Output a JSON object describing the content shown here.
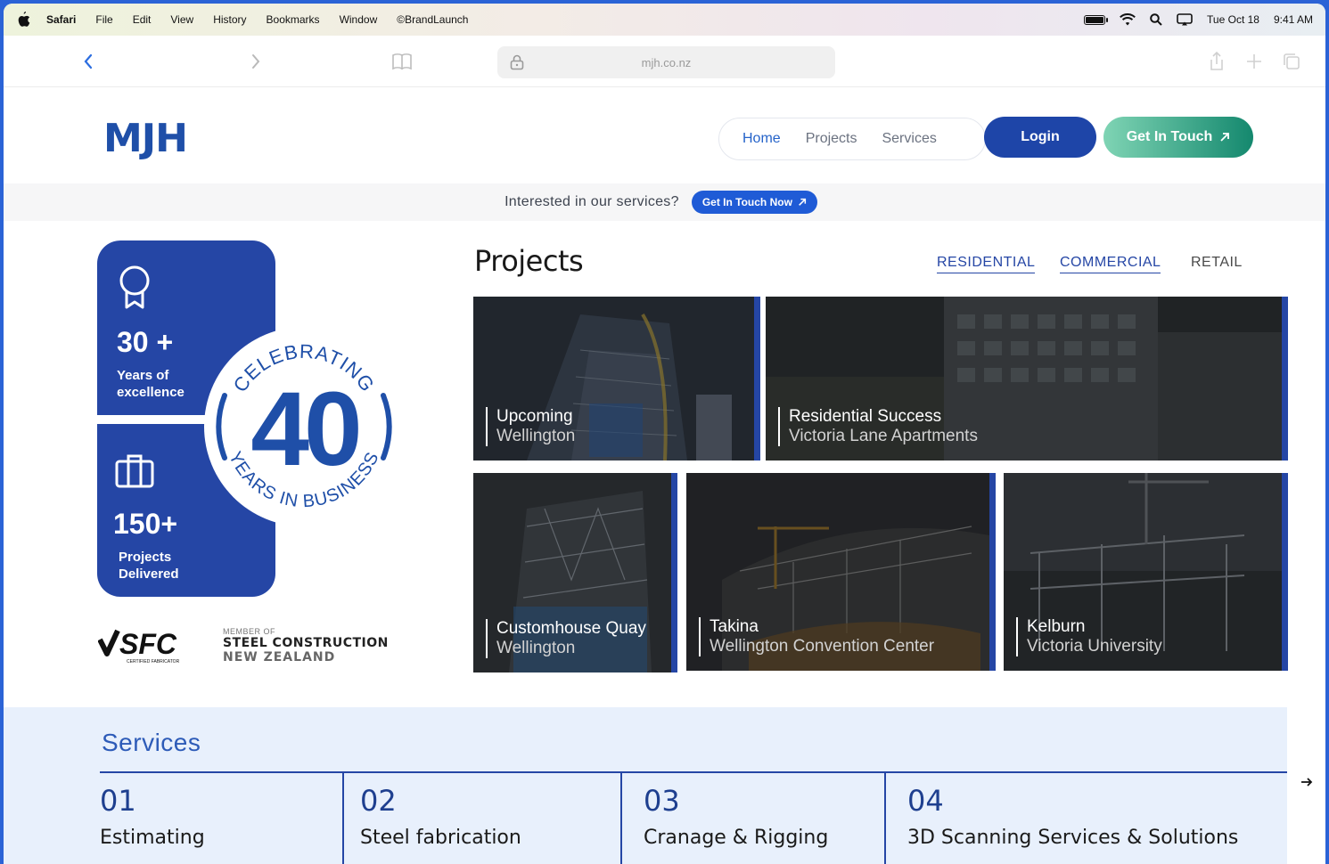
{
  "menubar": {
    "items": [
      "Safari",
      "File",
      "Edit",
      "View",
      "History",
      "Bookmarks",
      "Window",
      "©BrandLaunch"
    ],
    "date": "Tue Oct 18",
    "time": "9:41 AM"
  },
  "browser": {
    "url": "mjh.co.nz"
  },
  "site": {
    "logo": "MJH",
    "nav": [
      "Home",
      "Projects",
      "Services"
    ],
    "login_label": "Login",
    "get_in_touch_label": "Get In Touch"
  },
  "banner": {
    "text": "Interested in our services?",
    "button_label": "Get In Touch Now"
  },
  "stats": {
    "years": {
      "value": "30 +",
      "label_line1": "Years of",
      "label_line2": "excellence"
    },
    "projects": {
      "value": "150+",
      "label_line1": "Projects",
      "label_line2": "Delivered"
    }
  },
  "badge": {
    "top_text": "CELEBRATING",
    "number": "40",
    "bottom_text": "YEARS IN BUSINESS"
  },
  "partners": {
    "sfc": "SFC",
    "sfc_sub": "CERTIFIED FABRICATOR",
    "scnz_member": "MEMBER OF",
    "scnz_line1": "STEEL CONSTRUCTION",
    "scnz_line2": "NEW ZEALAND"
  },
  "projects": {
    "title": "Projects",
    "filters": [
      "RESIDENTIAL",
      "COMMERCIAL",
      "RETAIL"
    ],
    "tiles": [
      {
        "title": "Upcoming",
        "subtitle": "Wellington"
      },
      {
        "title": "Residential Success",
        "subtitle": "Victoria Lane Apartments"
      },
      {
        "title": "Customhouse Quay",
        "subtitle": "Wellington"
      },
      {
        "title": "Takina",
        "subtitle": "Wellington Convention Center"
      },
      {
        "title": "Kelburn",
        "subtitle": "Victoria University"
      }
    ]
  },
  "services": {
    "title": "Services",
    "items": [
      {
        "num": "01",
        "label": "Estimating"
      },
      {
        "num": "02",
        "label": "Steel fabrication"
      },
      {
        "num": "03",
        "label": "Cranage & Rigging"
      },
      {
        "num": "04",
        "label": "3D Scanning Services & Solutions"
      }
    ]
  },
  "colors": {
    "brand_blue": "#2546a5",
    "accent_green": "#14886e",
    "link_blue": "#2563c9"
  }
}
